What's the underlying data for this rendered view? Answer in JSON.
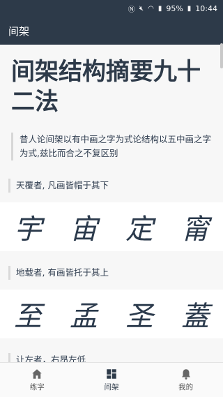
{
  "status": {
    "battery": "95%",
    "time": "10:44",
    "icons": [
      "nfc-icon",
      "mute-icon",
      "wifi-icon",
      "signal-icon",
      "battery-icon"
    ]
  },
  "appbar": {
    "title": "间架"
  },
  "page": {
    "title": "间架结构摘要九十二法",
    "intro": "昔人论间架以有中画之字为式论结构以五中画之字为式,兹比而合之不复区别"
  },
  "sections": [
    {
      "heading": "天覆者, 凡画皆帽于其下",
      "glyphs": [
        "宇",
        "宙",
        "定",
        "甯"
      ]
    },
    {
      "heading": "地载者, 有画皆托于其上",
      "glyphs": [
        "至",
        "孟",
        "圣",
        "蓋"
      ]
    },
    {
      "heading": "让左者，右昂左低"
    }
  ],
  "bottom_nav": [
    {
      "label": "练字",
      "icon": "home-icon"
    },
    {
      "label": "间架",
      "icon": "grid-icon"
    },
    {
      "label": "我的",
      "icon": "bell-icon"
    }
  ],
  "colors": {
    "bar": "#2d3a49",
    "text": "#2f3d4f"
  }
}
